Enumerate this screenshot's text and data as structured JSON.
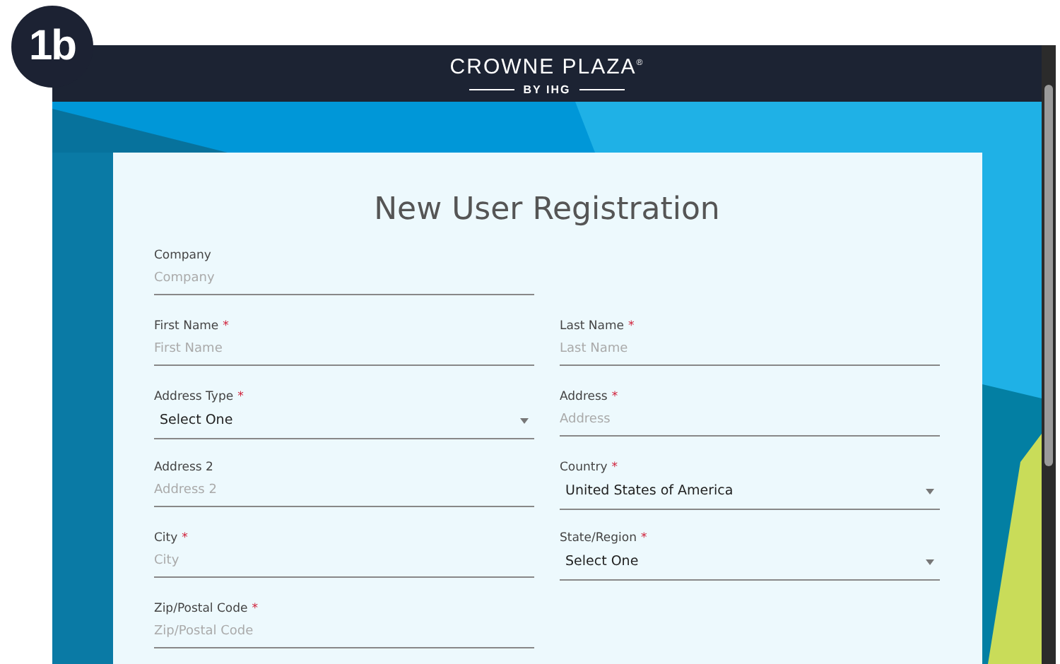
{
  "badge": {
    "label": "1b"
  },
  "header": {
    "logo": "CROWNE PLAZA$^{®}$",
    "logo_sub": "BY IHG"
  },
  "form": {
    "title": "New User Registration",
    "rows": [
      {
        "fields": [
          {
            "kind": "input",
            "label": "Company",
            "placeholder": "Company"
          }
        ]
      },
      {
        "fields": [
          {
            "kind": "input",
            "label": "First Name",
            "required_mark": "*",
            "placeholder": "First Name"
          },
          {
            "kind": "input",
            "label": "Last Name",
            "required_mark": "*",
            "placeholder": "Last Name"
          }
        ]
      },
      {
        "fields": [
          {
            "kind": "select",
            "label": "Address Type",
            "required_mark": "*",
            "value": "Select One"
          },
          {
            "kind": "input",
            "label": "Address",
            "required_mark": "*",
            "placeholder": "Address"
          }
        ]
      },
      {
        "fields": [
          {
            "kind": "input",
            "label": "Address 2",
            "placeholder": "Address 2"
          },
          {
            "kind": "select",
            "label": "Country",
            "required_mark": "*",
            "value": "United States of America"
          }
        ]
      },
      {
        "fields": [
          {
            "kind": "input",
            "label": "City",
            "required_mark": "*",
            "placeholder": "City"
          },
          {
            "kind": "select",
            "label": "State/Region",
            "required_mark": "*",
            "value": "Select One"
          }
        ]
      },
      {
        "fields": [
          {
            "kind": "input",
            "label": "Zip/Postal Code",
            "required_mark": "*",
            "placeholder": "Zip/Postal Code"
          }
        ]
      }
    ]
  }
}
